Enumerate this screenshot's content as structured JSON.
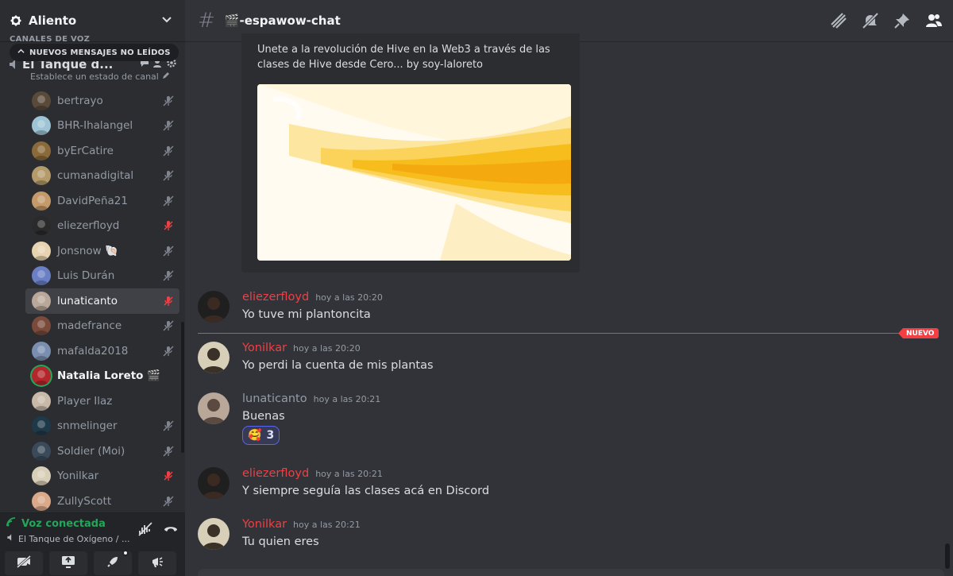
{
  "server": {
    "name": "Aliento"
  },
  "sidebar": {
    "category_label": "CANALES DE VOZ",
    "unread_pill": "NUEVOS MENSAJES NO LEÍDOS",
    "voice_channel": {
      "name": "El Tanque d...",
      "status": "Establece un estado de canal"
    },
    "members": [
      {
        "name": "bertrayo",
        "status": "muted",
        "avatar_color": "#5a4a3a"
      },
      {
        "name": "BHR-Ihalangel",
        "status": "muted",
        "avatar_color": "#9ec4d6"
      },
      {
        "name": "byErCatire",
        "status": "muted",
        "avatar_color": "#8a6a3a"
      },
      {
        "name": "cumanadigital",
        "status": "muted",
        "avatar_color": "#b59a6a"
      },
      {
        "name": "DavidPeña21",
        "status": "muted",
        "avatar_color": "#c49a6a"
      },
      {
        "name": "eliezerfloyd",
        "status": "mic-off-red",
        "avatar_color": "#2a2a2a"
      },
      {
        "name": "Jonsnow 🐚",
        "status": "muted",
        "avatar_color": "#e8d3b0"
      },
      {
        "name": "Luis Durán",
        "status": "muted",
        "avatar_color": "#6b7fc4"
      },
      {
        "name": "lunaticanto",
        "status": "mic-off-red",
        "avatar_color": "#b9a89a",
        "selected": true
      },
      {
        "name": "madefrance",
        "status": "muted",
        "avatar_color": "#7a4a3a"
      },
      {
        "name": "mafalda2018",
        "status": "muted",
        "avatar_color": "#7a8fb0"
      },
      {
        "name": "Natalia Loreto 🎬",
        "status": "none",
        "avatar_color": "#b3262b",
        "bold": true,
        "speaking": true
      },
      {
        "name": "Player Ilaz",
        "status": "none",
        "avatar_color": "#c7b8a8"
      },
      {
        "name": "snmelinger",
        "status": "muted",
        "avatar_color": "#1e3a4a"
      },
      {
        "name": "Soldier (Moi)",
        "status": "muted",
        "avatar_color": "#3a4a5a"
      },
      {
        "name": "Yonilkar",
        "status": "mic-off-red",
        "avatar_color": "#d8cfb8"
      },
      {
        "name": "ZullyScott",
        "status": "muted",
        "avatar_color": "#d9a98a"
      }
    ]
  },
  "voice_panel": {
    "status": "Voz conectada",
    "channel": "El Tanque de Oxígeno / ..."
  },
  "channel": {
    "name": "🎬-espawow-chat"
  },
  "embed": {
    "description": "Unete a la revolución de Hive en la Web3 a través de las clases de Hive desde Cero... by soy-laloreto"
  },
  "messages": [
    {
      "author": "eliezerfloyd",
      "timestamp": "hoy a las 20:20",
      "content": "Yo tuve mi plantoncita",
      "color": "red"
    },
    {
      "author": "Yonilkar",
      "timestamp": "hoy a las 20:20",
      "content": "Yo perdi la cuenta de mis plantas",
      "color": "red"
    },
    {
      "author": "lunaticanto",
      "timestamp": "hoy a las 20:21",
      "content": "Buenas",
      "color": "gray",
      "reaction": {
        "emoji": "🥰",
        "count": "3"
      }
    },
    {
      "author": "eliezerfloyd",
      "timestamp": "hoy a las 20:21",
      "content": "Y siempre seguía las clases acá en Discord",
      "color": "red"
    },
    {
      "author": "Yonilkar",
      "timestamp": "hoy a las 20:21",
      "content": "Tu quien eres",
      "color": "red"
    }
  ],
  "new_badge": "NUEVO"
}
